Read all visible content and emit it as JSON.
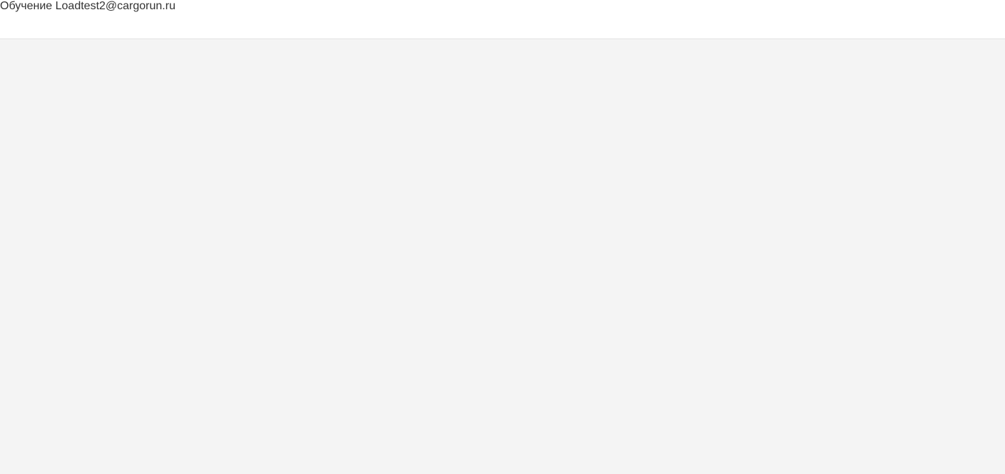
{
  "header": {
    "learn": "Обучение",
    "user": "Loadtest2@cargorun.ru"
  }
}
